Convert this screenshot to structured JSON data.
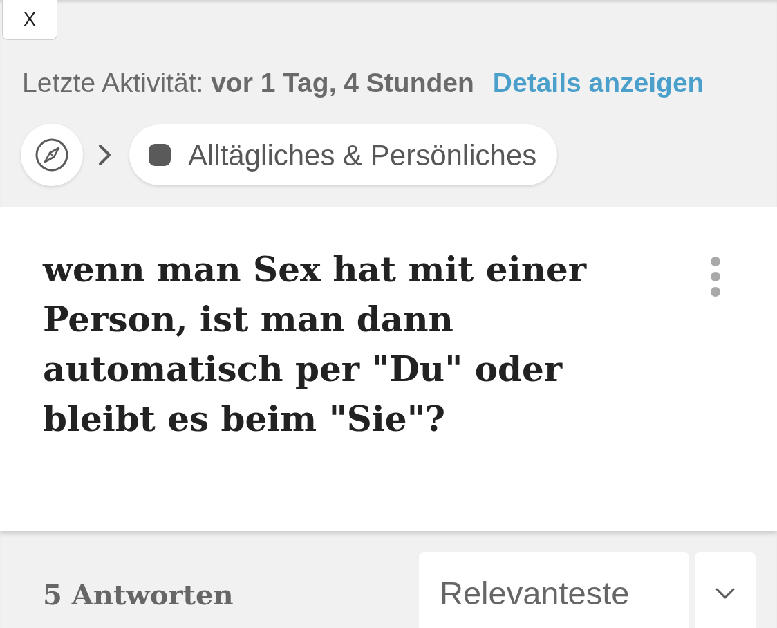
{
  "close_button": {
    "label": "X"
  },
  "activity": {
    "text": "Letzte Aktivität: **vor 1 Tag, 4 Stunden**",
    "link": "Details anzeigen"
  },
  "breadcrumb": {
    "category": "Alltägliches & Persönliches"
  },
  "question": {
    "title": "wenn man Sex hat mit einer Person, ist man dann automatisch per \"Du\" oder bleibt es beim \"Sie\"?"
  },
  "answers": {
    "count": "5 Antworten",
    "sort": "Relevanteste"
  }
}
